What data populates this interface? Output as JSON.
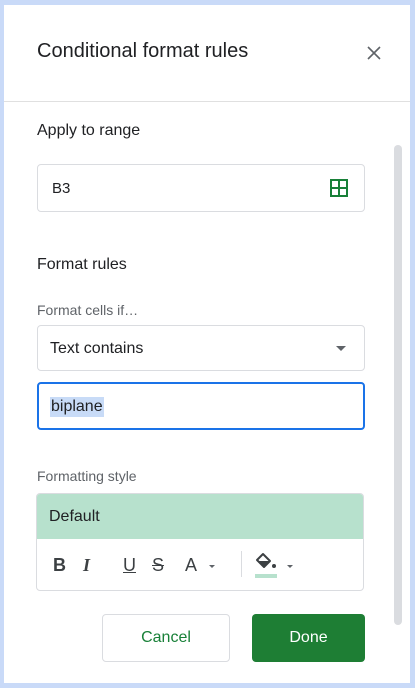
{
  "panel": {
    "title": "Conditional format rules",
    "close_icon": "close-icon"
  },
  "range": {
    "heading": "Apply to range",
    "value": "B3",
    "icon": "grid-select-icon",
    "icon_color": "#188038"
  },
  "rules": {
    "heading": "Format rules",
    "condition_label": "Format cells if…",
    "condition_selected": "Text contains",
    "condition_value": "biplane"
  },
  "style": {
    "heading": "Formatting style",
    "preview_label": "Default",
    "preview_bg": "#b7e1cd",
    "toolbar": {
      "bold": "B",
      "italic": "I",
      "underline": "U",
      "strikethrough": "S",
      "text_color": "A",
      "fill_color_icon": "fill-color-icon"
    }
  },
  "actions": {
    "cancel_label": "Cancel",
    "done_label": "Done",
    "done_bg": "#1e7e34"
  }
}
